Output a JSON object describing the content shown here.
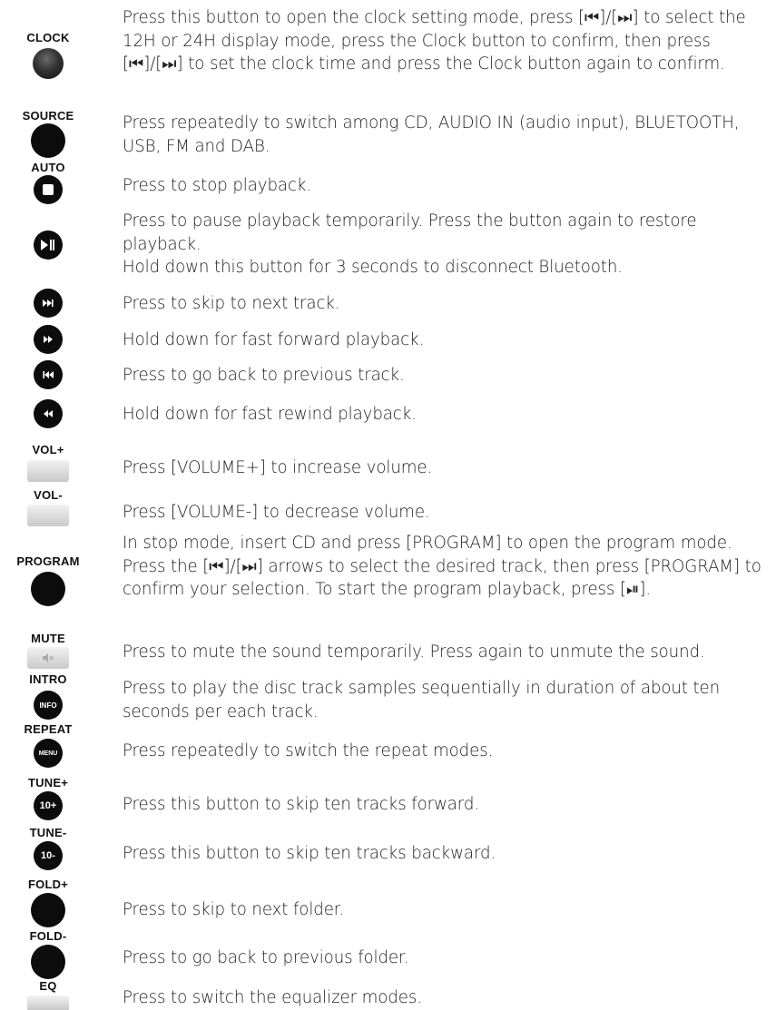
{
  "entries": [
    {
      "label": "CLOCK",
      "lines": [
        "Press this button to open the clock setting mode, press [⏮]/[⏭] to select the 12H or 24H display mode, press the Clock button to confirm, then press [⏮]/[⏭] to set the clock time and press the Clock button again to confirm."
      ]
    },
    {
      "label": "SOURCE",
      "lines": [
        "Press repeatedly to switch among CD, AUDIO IN (audio input), BLUETOOTH, USB, FM and DAB."
      ]
    },
    {
      "label": "AUTO",
      "lines": [
        "Press to stop playback."
      ]
    },
    {
      "label": "",
      "lines": [
        "Press to pause playback temporarily. Press the button again to restore playback.",
        "Hold down this button for 3 seconds to disconnect Bluetooth."
      ]
    },
    {
      "label": "",
      "lines": [
        "Press to skip to next track."
      ]
    },
    {
      "label": "",
      "lines": [
        "Hold down for fast forward playback."
      ]
    },
    {
      "label": "",
      "lines": [
        "Press to go back to previous track."
      ]
    },
    {
      "label": "",
      "lines": [
        "Hold down for fast rewind playback."
      ]
    },
    {
      "label": "VOL+",
      "lines": [
        "Press [VOLUME+] to increase volume."
      ]
    },
    {
      "label": "VOL-",
      "lines": [
        "Press [VOLUME-] to decrease volume."
      ]
    },
    {
      "label": "PROGRAM",
      "lines": [
        "In stop mode, insert CD and press [PROGRAM] to open the program mode. Press the [⏮]/[⏭] arrows to select the desired track, then press [PROGRAM] to confirm your selection. To start the program playback, press [⏯]."
      ]
    },
    {
      "label": "MUTE",
      "lines": [
        "Press to mute the sound temporarily. Press again to unmute the sound."
      ]
    },
    {
      "label": "INTRO",
      "button_text": "INFO",
      "lines": [
        "Press to play the disc track samples sequentially in duration of about ten seconds per each track."
      ]
    },
    {
      "label": "REPEAT",
      "button_text": "MENU",
      "lines": [
        "Press repeatedly to switch the repeat modes."
      ]
    },
    {
      "label": "TUNE+",
      "button_text": "10+",
      "lines": [
        "Press this button to skip ten tracks forward."
      ]
    },
    {
      "label": "TUNE-",
      "button_text": "10-",
      "lines": [
        "Press this button to skip ten tracks backward."
      ]
    },
    {
      "label": "FOLD+",
      "lines": [
        "Press to skip to next folder."
      ]
    },
    {
      "label": "FOLD-",
      "lines": [
        "Press to go back to previous folder."
      ]
    },
    {
      "label": "EQ",
      "lines": [
        "Press to switch the equalizer modes."
      ]
    }
  ]
}
